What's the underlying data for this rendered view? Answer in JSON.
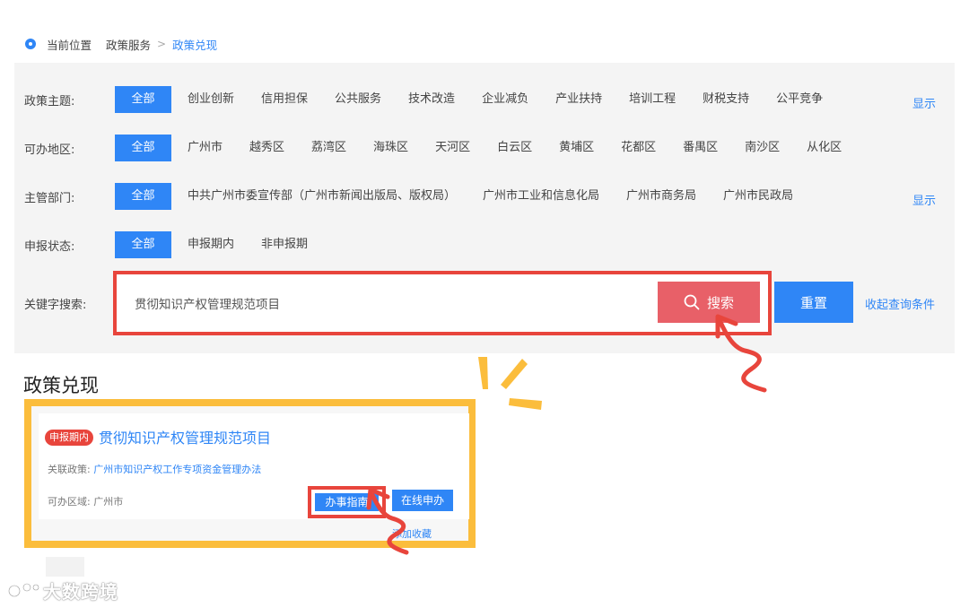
{
  "breadcrumb": {
    "label": "当前位置",
    "items": [
      "政策服务",
      "政策兑现"
    ],
    "separator": ">"
  },
  "filters": {
    "all_label": "全部",
    "show_label": "显示",
    "rows": [
      {
        "label": "政策主题:",
        "options": [
          "创业创新",
          "信用担保",
          "公共服务",
          "技术改造",
          "企业减负",
          "产业扶持",
          "培训工程",
          "财税支持",
          "公平竞争"
        ]
      },
      {
        "label": "可办地区:",
        "options": [
          "广州市",
          "越秀区",
          "荔湾区",
          "海珠区",
          "天河区",
          "白云区",
          "黄埔区",
          "花都区",
          "番禺区",
          "南沙区",
          "从化区"
        ]
      },
      {
        "label": "主管部门:",
        "options": [
          "中共广州市委宣传部（广州市新闻出版局、版权局）",
          "广州市工业和信息化局",
          "广州市商务局",
          "广州市民政局"
        ]
      },
      {
        "label": "申报状态:",
        "options": [
          "申报期内",
          "非申报期"
        ]
      }
    ],
    "keyword_label": "关键字搜索:",
    "keyword_value": "贯彻知识产权管理规范项目",
    "search_label": "搜索",
    "reset_label": "重置",
    "collapse_label": "收起查询条件"
  },
  "results": {
    "section_title": "政策兑现",
    "card": {
      "status": "申报期内",
      "title": "贯彻知识产权管理规范项目",
      "policy_label": "关联政策:",
      "policy_value": "广州市知识产权工作专项资金管理办法",
      "region_label": "可办区域:",
      "region_value": "广州市",
      "guide_label": "办事指南",
      "apply_label": "在线申办",
      "favorite_label": "添加收藏"
    }
  },
  "watermark": "大数跨境",
  "colors": {
    "primary": "#2f86f6",
    "highlight_red": "#e8453c",
    "highlight_yellow": "#fbbd3c",
    "search_button": "#e86068",
    "panel_bg": "#f4f4f4"
  }
}
